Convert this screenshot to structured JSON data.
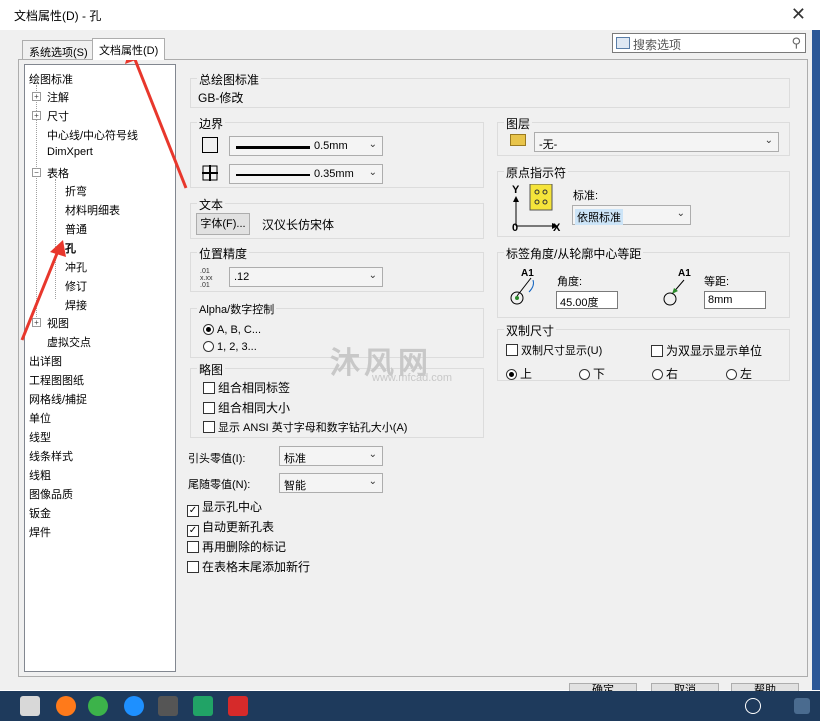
{
  "window": {
    "title": "文档属性(D) - 孔"
  },
  "tabs": [
    {
      "label": "系统选项(S)"
    },
    {
      "label": "文档属性(D)"
    }
  ],
  "search": {
    "placeholder": "搜索选项"
  },
  "tree": {
    "items": [
      {
        "label": "绘图标准"
      },
      {
        "label": "注解"
      },
      {
        "label": "尺寸"
      },
      {
        "label": "中心线/中心符号线"
      },
      {
        "label": "DimXpert"
      },
      {
        "label": "表格"
      },
      {
        "label": "折弯"
      },
      {
        "label": "材料明细表"
      },
      {
        "label": "普通"
      },
      {
        "label": "孔"
      },
      {
        "label": "冲孔"
      },
      {
        "label": "修订"
      },
      {
        "label": "焊接"
      },
      {
        "label": "视图"
      },
      {
        "label": "虚拟交点"
      },
      {
        "label": "出详图"
      },
      {
        "label": "工程图图纸"
      },
      {
        "label": "网格线/捕捉"
      },
      {
        "label": "单位"
      },
      {
        "label": "线型"
      },
      {
        "label": "线条样式"
      },
      {
        "label": "线粗"
      },
      {
        "label": "图像品质"
      },
      {
        "label": "钣金"
      },
      {
        "label": "焊件"
      }
    ]
  },
  "general_standard": {
    "title": "总绘图标准",
    "value": "GB-修改"
  },
  "border": {
    "title": "边界",
    "line1": "0.5mm",
    "line2": "0.35mm"
  },
  "text": {
    "title": "文本",
    "font_button": "字体(F)...",
    "font_name": "汉仪长仿宋体"
  },
  "precision": {
    "title": "位置精度",
    "value": ".12"
  },
  "alpha": {
    "title": "Alpha/数字控制",
    "opt1": "A, B, C...",
    "opt2": "1, 2, 3..."
  },
  "outline": {
    "title": "略图",
    "chk1": "组合相同标签",
    "chk2": "组合相同大小",
    "chk3": "显示 ANSI 英寸字母和数字钻孔大小(A)"
  },
  "leading_zero": {
    "label": "引头零值(I):",
    "value": "标准"
  },
  "trailing_zero": {
    "label": "尾随零值(N):",
    "value": "智能"
  },
  "options": {
    "show_center": "显示孔中心",
    "auto_update": "自动更新孔表",
    "reuse_deleted": "再用删除的标记",
    "add_row": "在表格末尾添加新行"
  },
  "layer": {
    "title": "图层",
    "value": "-无-"
  },
  "origin": {
    "title": "原点指示符",
    "std_label": "标准:",
    "std_value": "依照标准",
    "icon_y": "Y",
    "icon_x": "X",
    "icon_zero": "0"
  },
  "tag_angle": {
    "title": "标签角度/从轮廓中心等距",
    "angle_label": "角度:",
    "angle_value": "45.00度",
    "offset_label": "等距:",
    "offset_value": "8mm",
    "glyph": "A1"
  },
  "dual": {
    "title": "双制尺寸",
    "show": "双制尺寸显示(U)",
    "show_units": "为双显示显示单位",
    "top": "上",
    "bottom": "下",
    "right": "右",
    "left": "左"
  },
  "footer": {
    "ok": "确定",
    "cancel": "取消",
    "help": "帮助"
  },
  "watermark": {
    "main": "沐风网",
    "sub": "www.mfcad.com"
  },
  "colors": {
    "accent": "#0078d7",
    "arrow": "#e8372c",
    "taskbar": "#1e3a5c"
  }
}
